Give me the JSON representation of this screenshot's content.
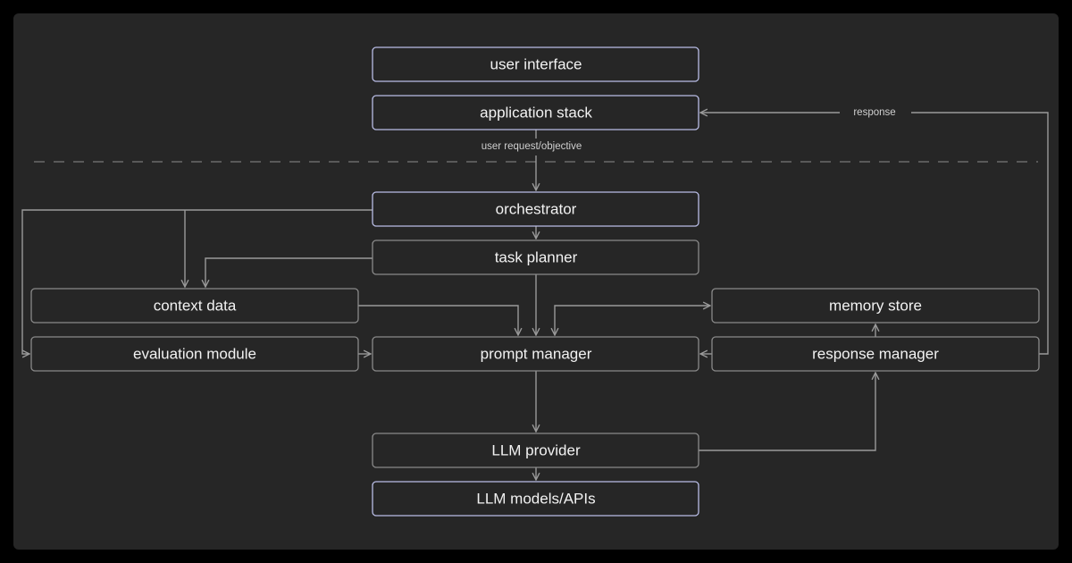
{
  "colors": {
    "background": "#262626",
    "accent_border": "#b9bde6",
    "border": "#8a8a8a",
    "connector": "#9a9a9a"
  },
  "nodes": {
    "user_interface": "user interface",
    "application_stack": "application stack",
    "orchestrator": "orchestrator",
    "task_planner": "task planner",
    "context_data": "context data",
    "evaluation_module": "evaluation module",
    "prompt_manager": "prompt manager",
    "memory_store": "memory store",
    "response_manager": "response manager",
    "llm_provider": "LLM provider",
    "llm_models": "LLM models/APIs"
  },
  "edge_labels": {
    "user_request": "user request/objective",
    "response": "response"
  }
}
